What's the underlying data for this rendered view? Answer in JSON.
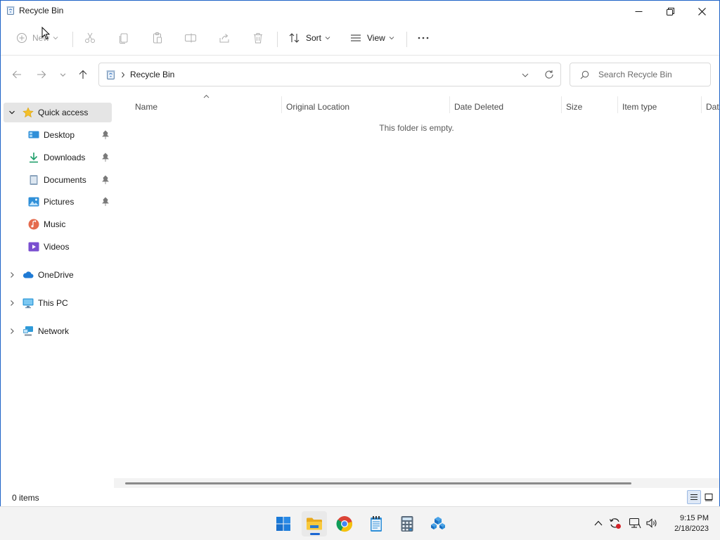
{
  "window": {
    "title": "Recycle Bin"
  },
  "toolbar": {
    "new_label": "New",
    "sort_label": "Sort",
    "view_label": "View"
  },
  "address": {
    "crumb": "Recycle Bin",
    "search_placeholder": "Search Recycle Bin"
  },
  "sidebar": {
    "quick_access": "Quick access",
    "items": [
      {
        "label": "Desktop",
        "icon": "desktop-icon",
        "pinned": true
      },
      {
        "label": "Downloads",
        "icon": "download-icon",
        "pinned": true
      },
      {
        "label": "Documents",
        "icon": "document-icon",
        "pinned": true
      },
      {
        "label": "Pictures",
        "icon": "pictures-icon",
        "pinned": true
      },
      {
        "label": "Music",
        "icon": "music-icon",
        "pinned": false
      },
      {
        "label": "Videos",
        "icon": "videos-icon",
        "pinned": false
      }
    ],
    "onedrive": "OneDrive",
    "this_pc": "This PC",
    "network": "Network"
  },
  "content": {
    "columns": [
      "Name",
      "Original Location",
      "Date Deleted",
      "Size",
      "Item type",
      "Dat"
    ],
    "empty_message": "This folder is empty."
  },
  "status": {
    "item_count": "0 items"
  },
  "taskbar": {
    "time": "9:15 PM",
    "date": "2/18/2023"
  },
  "colors": {
    "accent": "#1a66d2",
    "window_border": "#1e63c7",
    "selected_bg": "#e5e5e5"
  }
}
